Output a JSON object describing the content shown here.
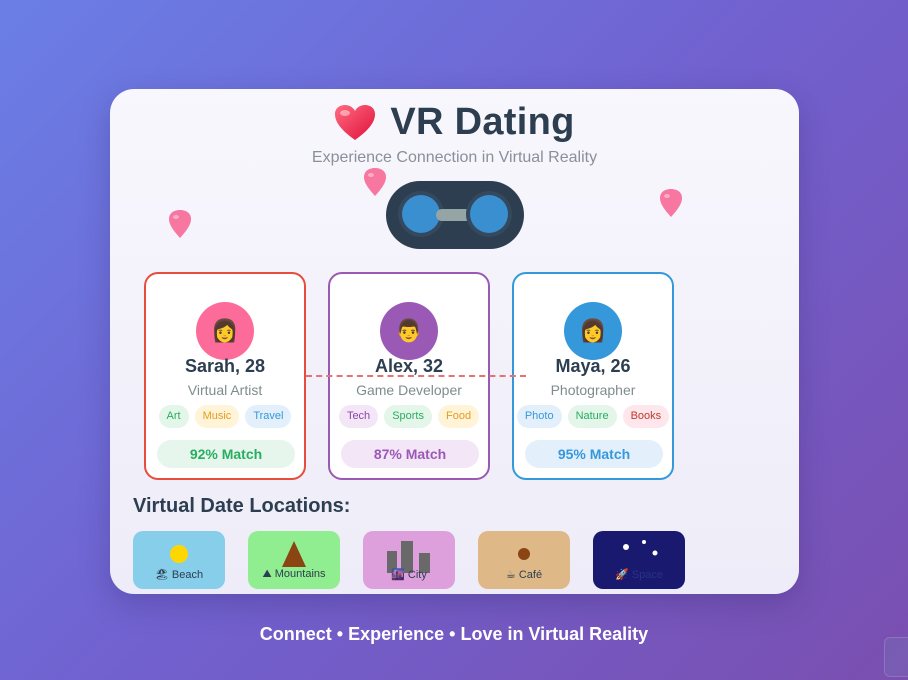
{
  "app": {
    "title": "VR Dating",
    "subtitle": "Experience Connection in Virtual Reality",
    "title_icon": "heart-icon",
    "accent": "#e74c3c"
  },
  "profiles": [
    {
      "name": "Sarah, 28",
      "role": "Virtual Artist",
      "avatar": "👩",
      "avatar_color": "#fd6b9a",
      "border_color": "#e74c3c",
      "tags": [
        {
          "label": "Art",
          "bg": "#e4f5e9",
          "fg": "#27ae60"
        },
        {
          "label": "Music",
          "bg": "#fff3d8",
          "fg": "#e69c1a"
        },
        {
          "label": "Travel",
          "bg": "#e3f0fb",
          "fg": "#3498db"
        }
      ],
      "match": "92% Match",
      "match_bg": "#e7f6ec",
      "match_fg": "#27ae60"
    },
    {
      "name": "Alex, 32",
      "role": "Game Developer",
      "avatar": "👨",
      "avatar_color": "#9b59b6",
      "border_color": "#9b59b6",
      "tags": [
        {
          "label": "Tech",
          "bg": "#f3e6f7",
          "fg": "#8e44ad"
        },
        {
          "label": "Sports",
          "bg": "#e4f5e9",
          "fg": "#27ae60"
        },
        {
          "label": "Food",
          "bg": "#fff3d8",
          "fg": "#e69c1a"
        }
      ],
      "match": "87% Match",
      "match_bg": "#f3e6f7",
      "match_fg": "#9b59b6"
    },
    {
      "name": "Maya, 26",
      "role": "Photographer",
      "avatar": "👩",
      "avatar_color": "#3498db",
      "border_color": "#3498db",
      "tags": [
        {
          "label": "Photo",
          "bg": "#e3f0fb",
          "fg": "#3498db"
        },
        {
          "label": "Nature",
          "bg": "#e4f5e9",
          "fg": "#27ae60"
        },
        {
          "label": "Books",
          "bg": "#fde6ec",
          "fg": "#c0392b"
        }
      ],
      "match": "95% Match",
      "match_bg": "#e3f0fb",
      "match_fg": "#3498db"
    }
  ],
  "locations_title": "Virtual Date Locations:",
  "locations": [
    {
      "label": "🏖 Beach",
      "bg": "#87ceeb",
      "icon": "sun-icon"
    },
    {
      "label": "⛰ Mountains",
      "bg": "#90ee90",
      "icon": "mountain-icon"
    },
    {
      "label": "🌆 City",
      "bg": "#dda0dd",
      "icon": "buildings-icon"
    },
    {
      "label": "☕ Café",
      "bg": "#deb887",
      "icon": "coffee-icon"
    },
    {
      "label": "🚀 Space",
      "bg": "#191970",
      "icon": "stars-icon"
    }
  ],
  "footer": "Connect • Experience • Love in Virtual Reality"
}
